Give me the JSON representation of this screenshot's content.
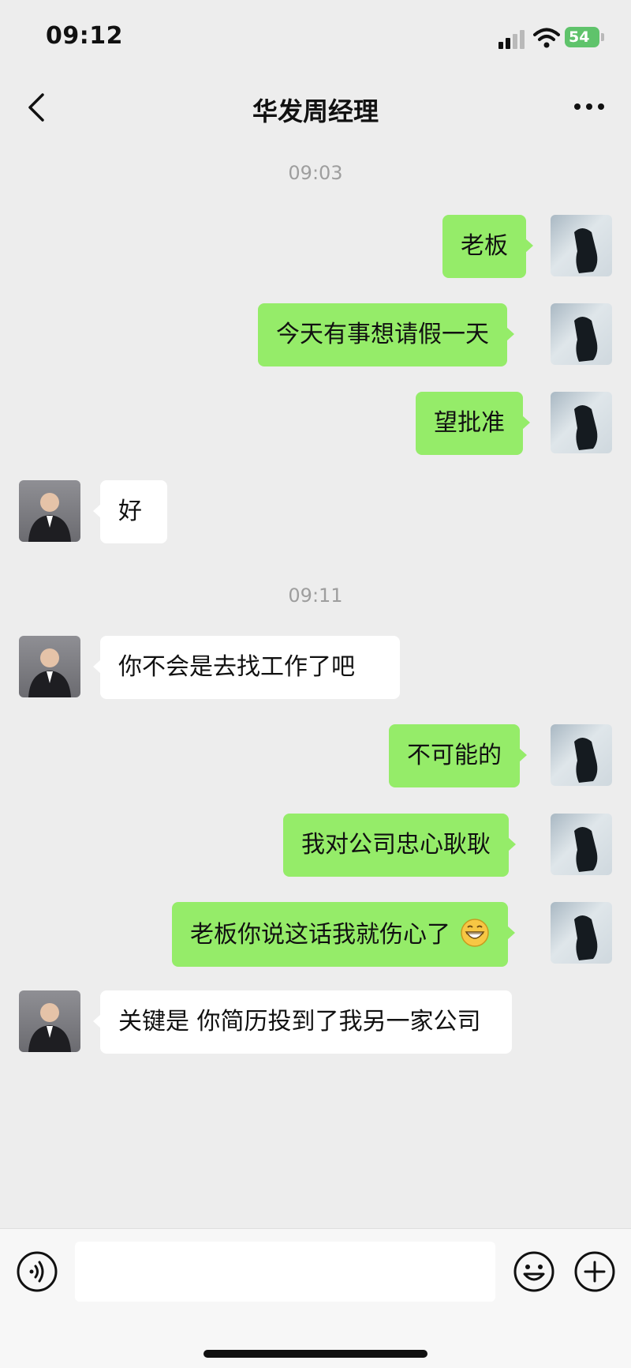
{
  "status_bar": {
    "time": "09:12",
    "battery": "54"
  },
  "header": {
    "title": "华发周经理"
  },
  "timestamps": [
    "09:03",
    "09:11"
  ],
  "messages": [
    {
      "from": "me",
      "text": "老板"
    },
    {
      "from": "me",
      "text": "今天有事想请假一天"
    },
    {
      "from": "me",
      "text": "望批准"
    },
    {
      "from": "other",
      "text": "好"
    },
    {
      "from": "other",
      "text": "你不会是去找工作了吧"
    },
    {
      "from": "me",
      "text": "不可能的"
    },
    {
      "from": "me",
      "text": "我对公司忠心耿耿"
    },
    {
      "from": "me",
      "text": "老板你说这话我就伤心了"
    },
    {
      "from": "other",
      "text": "关键是 你简历投到了我另一家公司"
    }
  ],
  "input": {
    "value": "",
    "placeholder": ""
  },
  "icons": {
    "back": "chevron-left-icon",
    "more": "more-dots-icon",
    "voice": "voice-icon",
    "emoji": "emoji-icon",
    "plus": "plus-icon",
    "grin_emoji": "grinning-emoji"
  },
  "colors": {
    "self_bubble": "#95ec69",
    "other_bubble": "#ffffff",
    "background": "#ededed"
  }
}
